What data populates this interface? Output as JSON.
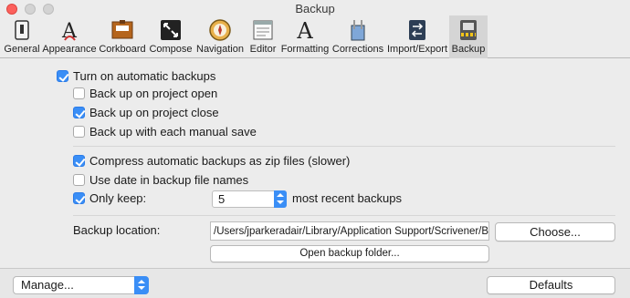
{
  "window": {
    "title": "Backup"
  },
  "toolbar": {
    "items": [
      {
        "label": "General",
        "icon": "general-icon"
      },
      {
        "label": "Appearance",
        "icon": "appearance-icon"
      },
      {
        "label": "Corkboard",
        "icon": "corkboard-icon"
      },
      {
        "label": "Compose",
        "icon": "compose-icon"
      },
      {
        "label": "Navigation",
        "icon": "navigation-icon"
      },
      {
        "label": "Editor",
        "icon": "editor-icon"
      },
      {
        "label": "Formatting",
        "icon": "formatting-icon"
      },
      {
        "label": "Corrections",
        "icon": "corrections-icon"
      },
      {
        "label": "Import/Export",
        "icon": "import-export-icon"
      },
      {
        "label": "Backup",
        "icon": "backup-icon",
        "selected": true
      }
    ]
  },
  "options": {
    "auto_backups": {
      "label": "Turn on automatic backups",
      "checked": true
    },
    "on_open": {
      "label": "Back up on project open",
      "checked": false
    },
    "on_close": {
      "label": "Back up on project close",
      "checked": true
    },
    "on_save": {
      "label": "Back up with each manual save",
      "checked": false
    },
    "compress": {
      "label": "Compress automatic backups as zip files (slower)",
      "checked": true
    },
    "use_date": {
      "label": "Use date in backup file names",
      "checked": false
    },
    "only_keep": {
      "label": "Only keep:",
      "checked": true,
      "value": "5",
      "suffix": "most recent backups"
    }
  },
  "location": {
    "label": "Backup location:",
    "path": "/Users/jparkeradair/Library/Application Support/Scrivener/Backups",
    "choose_label": "Choose...",
    "open_folder_label": "Open backup folder..."
  },
  "bottom": {
    "manage_label": "Manage...",
    "defaults_label": "Defaults"
  },
  "colors": {
    "accent": "#3a8ef6",
    "close": "#fc605c"
  }
}
